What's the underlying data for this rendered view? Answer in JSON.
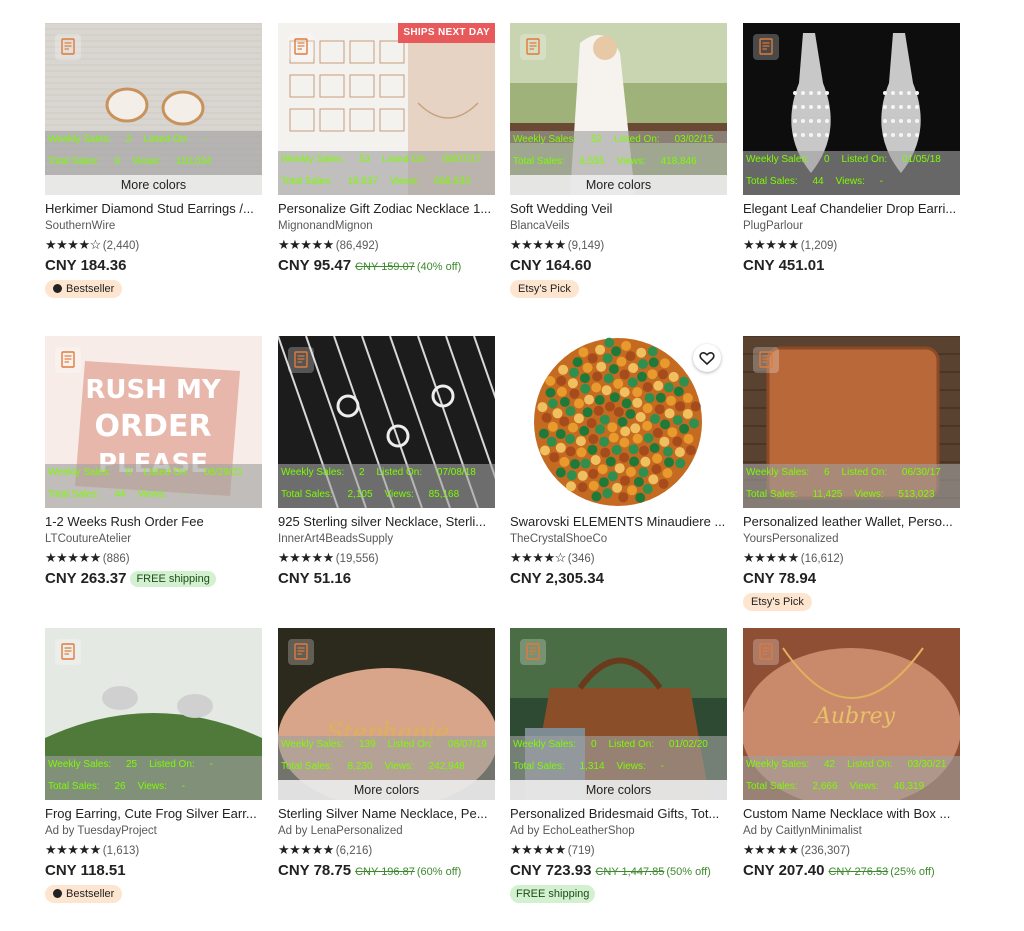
{
  "stat_labels": {
    "weekly_sales": "Weekly Sales:",
    "listed_on": "Listed On:",
    "total_sales": "Total Sales:",
    "views": "Views:"
  },
  "more_colors_label": "More colors",
  "ships_next_day_label": "SHIPS NEXT DAY",
  "icons": {
    "bookmark": "bookmark-note-icon",
    "favorite": "heart-icon",
    "bestseller": "award-icon"
  },
  "colors": {
    "stat_text": "#7cfc00",
    "sale_text": "#3d8a2e",
    "free_shipping_bg": "#d3f0d1",
    "badge_bg": "#fde5d0",
    "ships_bg": "#e8595b"
  },
  "products": [
    {
      "title": "Herkimer Diamond Stud Earrings /...",
      "shop": "SouthernWire",
      "stars": "★★★★☆",
      "rating": 4.5,
      "reviews": "(2,440)",
      "price": "CNY 184.36",
      "original_price": "",
      "discount": "",
      "free_shipping": "",
      "badge": "Bestseller",
      "badge_type": "bestseller",
      "more_colors": true,
      "ships_next_day": false,
      "favorite_visible": false,
      "weekly_sales": "2",
      "listed_on": "-",
      "total_sales": "6",
      "views": "110,034"
    },
    {
      "title": "Personalize Gift Zodiac Necklace 1...",
      "shop": "MignonandMignon",
      "stars": "★★★★★",
      "rating": 5,
      "reviews": "(86,492)",
      "price": "CNY 95.47",
      "original_price": "CNY 159.07",
      "discount": "(40% off)",
      "free_shipping": "",
      "badge": "",
      "badge_type": "",
      "more_colors": false,
      "ships_next_day": true,
      "favorite_visible": false,
      "weekly_sales": "53",
      "listed_on": "08/07/17",
      "total_sales": "19,537",
      "views": "668,533"
    },
    {
      "title": "Soft Wedding Veil",
      "shop": "BlancaVeils",
      "stars": "★★★★★",
      "rating": 5,
      "reviews": "(9,149)",
      "price": "CNY 164.60",
      "original_price": "",
      "discount": "",
      "free_shipping": "",
      "badge": "Etsy's Pick",
      "badge_type": "pick",
      "more_colors": true,
      "ships_next_day": false,
      "favorite_visible": false,
      "weekly_sales": "52",
      "listed_on": "03/02/15",
      "total_sales": "6,555",
      "views": "418,846"
    },
    {
      "title": "Elegant Leaf Chandelier Drop Earri...",
      "shop": "PlugParlour",
      "stars": "★★★★★",
      "rating": 5,
      "reviews": "(1,209)",
      "price": "CNY 451.01",
      "original_price": "",
      "discount": "",
      "free_shipping": "",
      "badge": "",
      "badge_type": "",
      "more_colors": false,
      "ships_next_day": false,
      "favorite_visible": false,
      "weekly_sales": "0",
      "listed_on": "01/05/18",
      "total_sales": "44",
      "views": "-"
    },
    {
      "title": "1-2 Weeks Rush Order Fee",
      "shop": "LTCoutureAtelier",
      "stars": "★★★★★",
      "rating": 5,
      "reviews": "(886)",
      "price": "CNY 263.37",
      "original_price": "",
      "discount": "",
      "free_shipping": "FREE shipping",
      "badge": "",
      "badge_type": "",
      "more_colors": false,
      "ships_next_day": false,
      "favorite_visible": false,
      "weekly_sales": "0",
      "listed_on": "06/29/21",
      "total_sales": "44",
      "views": "-"
    },
    {
      "title": "925 Sterling silver Necklace, Sterli...",
      "shop": "InnerArt4BeadsSupply",
      "stars": "★★★★★",
      "rating": 5,
      "reviews": "(19,556)",
      "price": "CNY 51.16",
      "original_price": "",
      "discount": "",
      "free_shipping": "",
      "badge": "",
      "badge_type": "",
      "more_colors": false,
      "ships_next_day": false,
      "favorite_visible": false,
      "weekly_sales": "2",
      "listed_on": "07/08/18",
      "total_sales": "2,105",
      "views": "85,168"
    },
    {
      "title": "Swarovski ELEMENTS Minaudiere ...",
      "shop": "TheCrystalShoeCo",
      "stars": "★★★★☆",
      "rating": 4.5,
      "reviews": "(346)",
      "price": "CNY 2,305.34",
      "original_price": "",
      "discount": "",
      "free_shipping": "",
      "badge": "",
      "badge_type": "",
      "more_colors": false,
      "ships_next_day": false,
      "favorite_visible": true,
      "weekly_sales": "",
      "listed_on": "",
      "total_sales": "",
      "views": ""
    },
    {
      "title": "Personalized leather Wallet, Perso...",
      "shop": "YoursPersonalized",
      "stars": "★★★★★",
      "rating": 5,
      "reviews": "(16,612)",
      "price": "CNY 78.94",
      "original_price": "",
      "discount": "",
      "free_shipping": "",
      "badge": "Etsy's Pick",
      "badge_type": "pick",
      "more_colors": false,
      "ships_next_day": false,
      "favorite_visible": false,
      "weekly_sales": "6",
      "listed_on": "06/30/17",
      "total_sales": "11,425",
      "views": "513,023"
    },
    {
      "title": "Frog Earring, Cute Frog Silver Earr...",
      "shop": "Ad by TuesdayProject",
      "stars": "★★★★★",
      "rating": 5,
      "reviews": "(1,613)",
      "price": "CNY 118.51",
      "original_price": "",
      "discount": "",
      "free_shipping": "",
      "badge": "Bestseller",
      "badge_type": "bestseller",
      "more_colors": false,
      "ships_next_day": false,
      "favorite_visible": false,
      "weekly_sales": "25",
      "listed_on": "-",
      "total_sales": "26",
      "views": "-"
    },
    {
      "title": "Sterling Silver Name Necklace, Pe...",
      "shop": "Ad by LenaPersonalized",
      "stars": "★★★★★",
      "rating": 5,
      "reviews": "(6,216)",
      "price": "CNY 78.75",
      "original_price": "CNY 196.87",
      "discount": "(60% off)",
      "free_shipping": "",
      "badge": "",
      "badge_type": "",
      "more_colors": true,
      "ships_next_day": false,
      "favorite_visible": false,
      "weekly_sales": "139",
      "listed_on": "08/07/19",
      "total_sales": "8,230",
      "views": "242,948"
    },
    {
      "title": "Personalized Bridesmaid Gifts, Tot...",
      "shop": "Ad by EchoLeatherShop",
      "stars": "★★★★★",
      "rating": 5,
      "reviews": "(719)",
      "price": "CNY 723.93",
      "original_price": "CNY 1,447.85",
      "discount": "(50% off)",
      "free_shipping": "FREE shipping",
      "badge": "",
      "badge_type": "",
      "more_colors": true,
      "ships_next_day": false,
      "favorite_visible": false,
      "weekly_sales": "0",
      "listed_on": "01/02/20",
      "total_sales": "1,314",
      "views": "-"
    },
    {
      "title": "Custom Name Necklace with Box ...",
      "shop": "Ad by CaitlynMinimalist",
      "stars": "★★★★★",
      "rating": 5,
      "reviews": "(236,307)",
      "price": "CNY 207.40",
      "original_price": "CNY 276.53",
      "discount": "(25% off)",
      "free_shipping": "",
      "badge": "",
      "badge_type": "",
      "more_colors": false,
      "ships_next_day": false,
      "favorite_visible": false,
      "weekly_sales": "42",
      "listed_on": "03/30/21",
      "total_sales": "2,666",
      "views": "46,319"
    }
  ]
}
